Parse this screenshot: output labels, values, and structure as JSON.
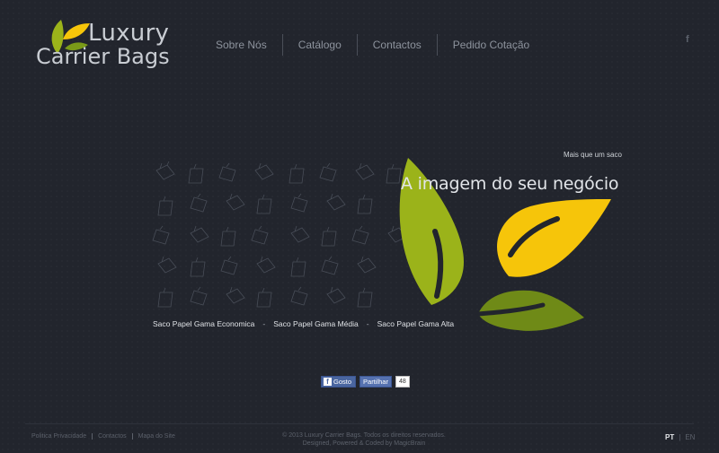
{
  "logo": {
    "line1": "Luxury",
    "line2": "Carrier Bags"
  },
  "nav": {
    "items": [
      {
        "label": "Sobre Nós"
      },
      {
        "label": "Catálogo"
      },
      {
        "label": "Contactos"
      },
      {
        "label": "Pedido Cotação"
      }
    ]
  },
  "header": {
    "facebook_icon": "f"
  },
  "hero": {
    "tagline_small": "Mais que um saco",
    "tagline_big": "A imagem do seu negócio",
    "ranges": [
      {
        "label": "Saco Papel Gama Economica"
      },
      {
        "label": "Saco Papel Gama Média"
      },
      {
        "label": "Saco Papel Gama Alta"
      }
    ],
    "separator": "-"
  },
  "social": {
    "like_icon": "f",
    "like_label": "Gosto",
    "share_label": "Partilhar",
    "count": "48"
  },
  "footer": {
    "links": [
      {
        "label": "Politica Privacidade"
      },
      {
        "label": "Contactos"
      },
      {
        "label": "Mapa do Site"
      }
    ],
    "copyright": "© 2013 Luxury Carrier Bags. Todos os direitos reservados.",
    "credits": "Designed, Powered & Coded by MagicBrain",
    "lang_pt": "PT",
    "lang_sep": "|",
    "lang_en": "EN"
  },
  "colors": {
    "background": "#22252d",
    "leaf_green": "#9bb31a",
    "leaf_yellow": "#f6c50a",
    "leaf_olive": "#6f8a17",
    "facebook_blue": "#4a66a0"
  }
}
